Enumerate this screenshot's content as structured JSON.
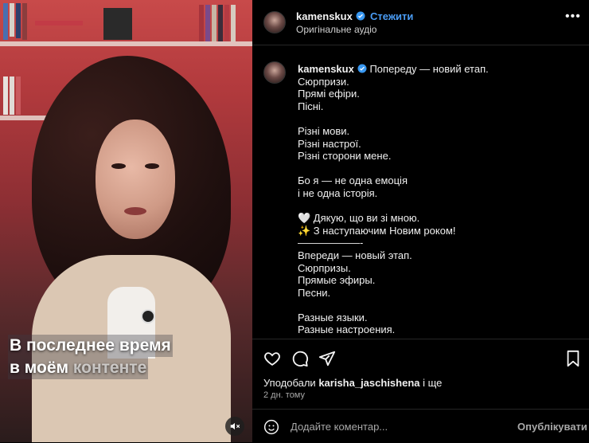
{
  "media": {
    "caption_line1": "В последнее время",
    "caption_line2_bright": "в моём ",
    "caption_line2_dim": "контенте",
    "mute_icon": "speaker-muted-icon"
  },
  "header": {
    "username": "kamenskux",
    "follow_label": "Стежити",
    "audio_label": "Оригінальне аудіо",
    "more_label": "•••"
  },
  "post": {
    "username": "kamenskux",
    "text": "Попереду — новий етап.\nСюрпризи.\nПрямі ефіри.\nПісні.\n\nРізні мови.\nРізні настрої.\nРізні сторони мене.\n\nБо я — не одна емоція\nі не одна історія.\n\n🤍 Дякую, що ви зі мною.\n✨ З наступаючим Новим роком!\n——————-\nВпереди — новый этап.\nСюрпризы.\nПрямые эфиры.\nПесни.\n\nРазные языки.\nРазные настроения.\nРазные стороны меня."
  },
  "actions": {
    "liked_by_prefix": "Уподобали ",
    "liked_by_user": "karisha_jaschishena",
    "liked_by_suffix": " і ще",
    "time": "2 дн. тому"
  },
  "comment": {
    "placeholder": "Додайте коментар...",
    "publish_label": "Опублікувати",
    "emoji_icon": "emoji-icon"
  },
  "colors": {
    "accent": "#4a9cf5",
    "background": "#000000",
    "verified": "#3897f0"
  }
}
